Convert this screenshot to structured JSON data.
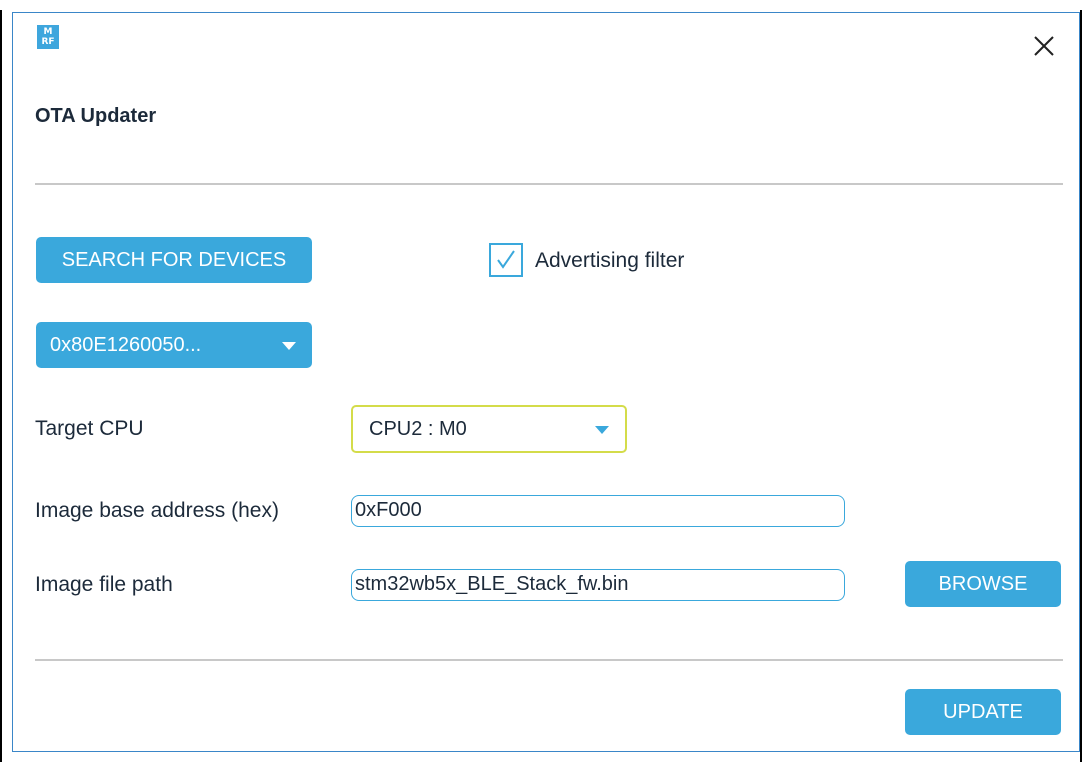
{
  "app": {
    "logo_text_top": "M",
    "logo_text_bottom": "RF",
    "title": "OTA Updater"
  },
  "colors": {
    "accent": "#3aa8dc",
    "focus_border": "#d4dc4a",
    "divider": "#c8c8c8",
    "text": "#1c2a3a"
  },
  "icons": {
    "close": "close-icon",
    "checkmark": "checkmark-icon",
    "dropdown": "chevron-down-icon"
  },
  "search": {
    "button_label": "SEARCH FOR DEVICES",
    "advertising_filter_label": "Advertising filter",
    "advertising_filter_checked": true
  },
  "device": {
    "selected": "0x80E1260050..."
  },
  "target_cpu": {
    "label": "Target CPU",
    "selected": "CPU2 : M0"
  },
  "image_base_address": {
    "label": "Image base address (hex)",
    "value": "0xF000"
  },
  "image_file_path": {
    "label": "Image file path",
    "value": "stm32wb5x_BLE_Stack_fw.bin",
    "browse_label": "BROWSE"
  },
  "actions": {
    "update_label": "UPDATE"
  }
}
